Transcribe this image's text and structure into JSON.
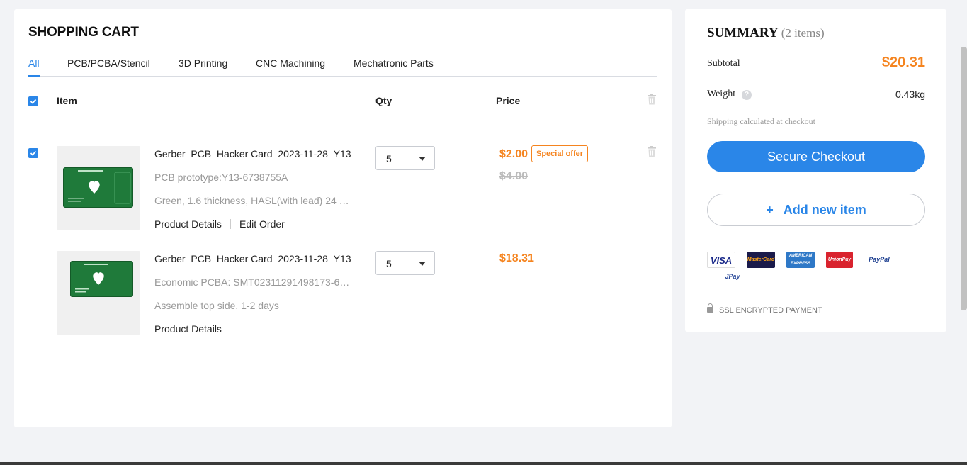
{
  "cart": {
    "title": "SHOPPING CART",
    "tabs": [
      {
        "label": "All",
        "active": true
      },
      {
        "label": "PCB/PCBA/Stencil",
        "active": false
      },
      {
        "label": "3D Printing",
        "active": false
      },
      {
        "label": "CNC Machining",
        "active": false
      },
      {
        "label": "Mechatronic Parts",
        "active": false
      }
    ],
    "columns": {
      "item": "Item",
      "qty": "Qty",
      "price": "Price"
    },
    "items": [
      {
        "name": "Gerber_PCB_Hacker Card_2023-11-28_Y13",
        "line1": "PCB prototype:Y13-6738755A",
        "line2": "Green, 1.6 thickness, HASL(with lead) 24 …",
        "links": [
          "Product Details",
          "Edit Order"
        ],
        "qty": "5",
        "price": "$2.00",
        "old_price": "$4.00",
        "badge": "Special offer",
        "checked": true
      },
      {
        "name": "Gerber_PCB_Hacker Card_2023-11-28_Y13",
        "line1": "Economic PCBA: SMT02311291498173-6…",
        "line2": "Assemble top side, 1-2 days",
        "links": [
          "Product Details"
        ],
        "qty": "5",
        "price": "$18.31"
      }
    ]
  },
  "summary": {
    "title": "SUMMARY",
    "count": "(2 items)",
    "subtotal_label": "Subtotal",
    "subtotal_value": "$20.31",
    "weight_label": "Weight",
    "weight_value": "0.43kg",
    "shipping_note": "Shipping calculated at checkout",
    "checkout_label": "Secure Checkout",
    "add_item_label": "Add new item",
    "payment_logos": [
      "VISA",
      "MasterCard",
      "AMERICAN EXPRESS",
      "UnionPay",
      "PayPal",
      "JPay"
    ],
    "ssl_label": "SSL ENCRYPTED PAYMENT"
  },
  "colors": {
    "accent": "#2a86e8",
    "price": "#f5841f"
  }
}
